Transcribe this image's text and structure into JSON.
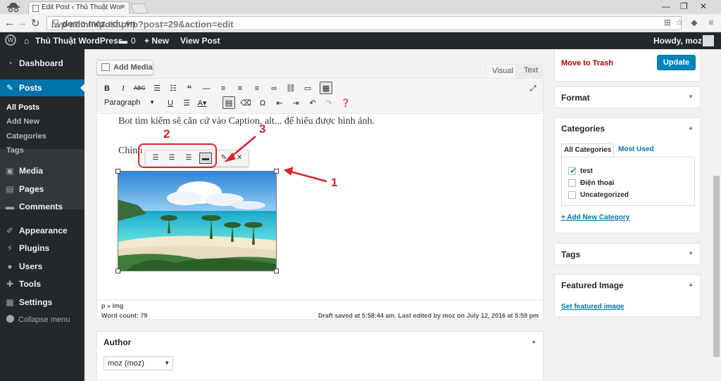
{
  "browser": {
    "tab_title": "Edit Post ‹ Thủ Thuật Wor",
    "url_host": "demo.moz.edu.vn",
    "url_path": "/wp-admin/post.php?post=29&action=edit"
  },
  "adminbar": {
    "site_name": "Thủ Thuật WordPress",
    "comments_count": "0",
    "new_label": "+ New",
    "view_post": "View Post",
    "howdy": "Howdy, moz"
  },
  "sidebar": {
    "items": [
      {
        "label": "Dashboard",
        "icon": "dashboard-icon"
      },
      {
        "label": "Posts",
        "icon": "pin-icon"
      },
      {
        "label": "Media",
        "icon": "media-icon"
      },
      {
        "label": "Pages",
        "icon": "pages-icon"
      },
      {
        "label": "Comments",
        "icon": "comment-icon"
      },
      {
        "label": "Appearance",
        "icon": "brush-icon"
      },
      {
        "label": "Plugins",
        "icon": "plug-icon"
      },
      {
        "label": "Users",
        "icon": "users-icon"
      },
      {
        "label": "Tools",
        "icon": "wrench-icon"
      },
      {
        "label": "Settings",
        "icon": "settings-icon"
      }
    ],
    "submenu": [
      "All Posts",
      "Add New",
      "Categories",
      "Tags"
    ],
    "collapse": "Collapse menu"
  },
  "editor": {
    "add_media": "Add Media",
    "tab_visual": "Visual",
    "tab_text": "Text",
    "format": "Paragraph",
    "line1": "Bot tìm kiếm sẽ căn cứ vào Caption, alt... để hiểu được hình ảnh.",
    "line2": "Chính",
    "path": "p » img",
    "word_count": "Word count: 79",
    "draft_status": "Draft saved at 5:58:44 am. Last edited by moz on July 12, 2016 at 5:59 pm"
  },
  "author": {
    "title": "Author",
    "value": "moz (moz)"
  },
  "publish": {
    "trash": "Move to Trash",
    "update": "Update"
  },
  "format_box": {
    "title": "Format"
  },
  "categories": {
    "title": "Categories",
    "tab_all": "All Categories",
    "tab_used": "Most Used",
    "items": [
      {
        "label": "test",
        "checked": true
      },
      {
        "label": "Điện thoại",
        "checked": false
      },
      {
        "label": "Uncategorized",
        "checked": false
      }
    ],
    "add_new": "+ Add New Category"
  },
  "tags_box": {
    "title": "Tags"
  },
  "featured": {
    "title": "Featured Image",
    "link": "Set featured image"
  },
  "annotations": {
    "n1": "1",
    "n2": "2",
    "n3": "3"
  },
  "colors": {
    "accent": "#0073aa",
    "annotation": "#e0202a",
    "adminbar": "#23282d"
  }
}
